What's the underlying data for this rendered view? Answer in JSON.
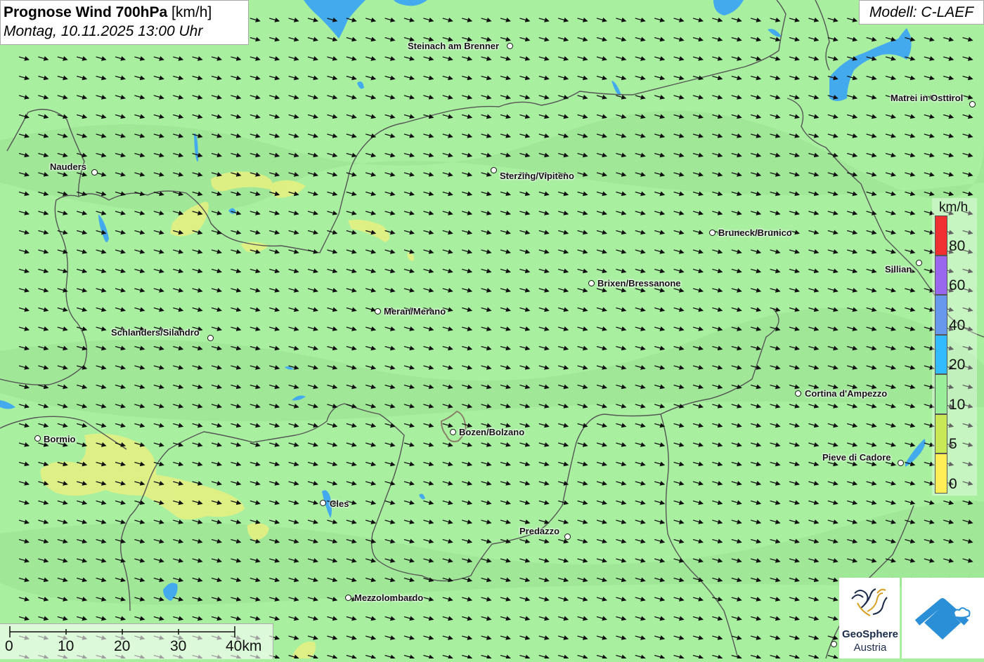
{
  "title": {
    "main": "Prognose Wind 700hPa",
    "unit": "[km/h]",
    "datetime": "Montag, 10.11.2025 13:00 Uhr"
  },
  "model": "Modell: C-LAEF",
  "cities": [
    {
      "name": "Steinach am Brenner",
      "key": "steinach"
    },
    {
      "name": "Matrei in Osttirol",
      "key": "matrei"
    },
    {
      "name": "Nauders",
      "key": "nauders"
    },
    {
      "name": "Sterzing/Vipiteno",
      "key": "sterzing"
    },
    {
      "name": "Bruneck/Brunico",
      "key": "bruneck"
    },
    {
      "name": "Sillian",
      "key": "sillian"
    },
    {
      "name": "Brixen/Bressanone",
      "key": "brixen"
    },
    {
      "name": "Meran/Merano",
      "key": "meran"
    },
    {
      "name": "Schlanders/Silandro",
      "key": "schlanders"
    },
    {
      "name": "Cortina d'Ampezzo",
      "key": "cortina"
    },
    {
      "name": "Bozen/Bolzano",
      "key": "bozen"
    },
    {
      "name": "Bormio",
      "key": "bormio"
    },
    {
      "name": "Pieve di Cadore",
      "key": "pieve"
    },
    {
      "name": "Cles",
      "key": "cles"
    },
    {
      "name": "Predazzo",
      "key": "predazzo"
    },
    {
      "name": "Mezzolombardo",
      "key": "mezzolombardo"
    }
  ],
  "legend": {
    "unit": "km/h",
    "labels": [
      "80",
      "60",
      "40",
      "20",
      "10",
      "5",
      "0"
    ],
    "colors": [
      "#f03030",
      "#9966ee",
      "#6699ee",
      "#33bbff",
      "#99ee99",
      "#c8e855",
      "#ffee55"
    ]
  },
  "scalebar": {
    "labels": [
      "0",
      "10",
      "20",
      "30",
      "40km"
    ]
  },
  "logos": {
    "geosphere_line1": "GeoSphere",
    "geosphere_line2": "Austria"
  },
  "colors": {
    "background": "#a8f0a0",
    "water": "#44aaee",
    "calm_zone": "#e8f080",
    "border": "#555555"
  },
  "wind_arrow_icon": "arrow-east-southeast-icon"
}
